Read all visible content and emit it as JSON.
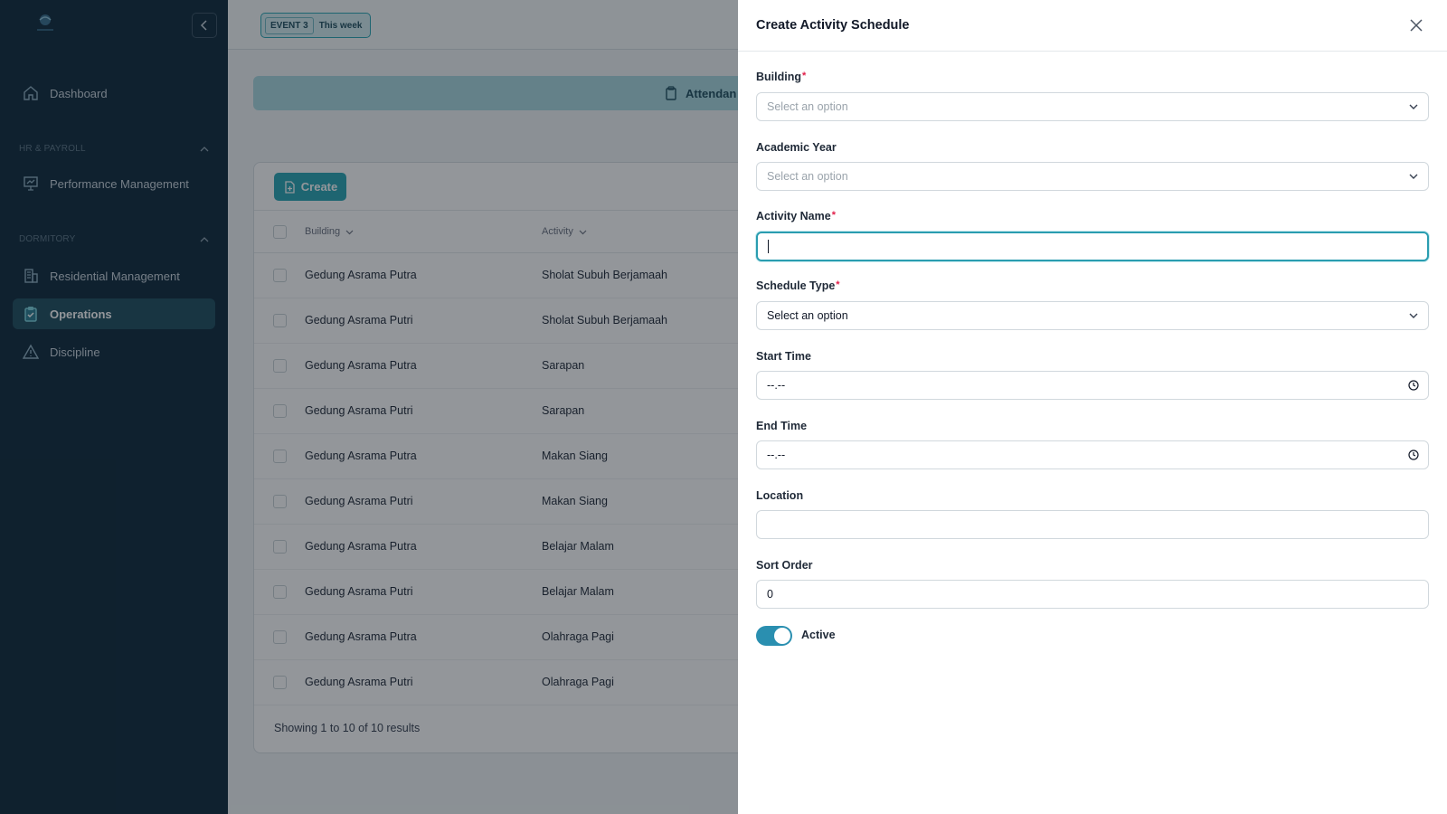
{
  "sidebar": {
    "logo_text": "GENERIC",
    "nav": [
      {
        "label": "Dashboard",
        "icon": "home-icon",
        "active": false
      },
      {
        "label": "Performance Management",
        "icon": "presentation-chart-icon",
        "active": false
      },
      {
        "label": "Residential Management",
        "icon": "building-icon",
        "active": false
      },
      {
        "label": "Operations",
        "icon": "clipboard-check-icon",
        "active": true
      },
      {
        "label": "Discipline",
        "icon": "warning-triangle-icon",
        "active": false
      }
    ],
    "sections": [
      {
        "label": "HR & PAYROLL"
      },
      {
        "label": "DORMITORY"
      }
    ]
  },
  "topbar": {
    "event_tag": "EVENT 3",
    "event_when": "This week"
  },
  "banner": {
    "label": "Attendan"
  },
  "table": {
    "create_label": "Create",
    "columns": [
      "Building",
      "Activity"
    ],
    "rows": [
      {
        "building": "Gedung Asrama Putra",
        "activity": "Sholat Subuh Berjamaah"
      },
      {
        "building": "Gedung Asrama Putri",
        "activity": "Sholat Subuh Berjamaah"
      },
      {
        "building": "Gedung Asrama Putra",
        "activity": "Sarapan"
      },
      {
        "building": "Gedung Asrama Putri",
        "activity": "Sarapan"
      },
      {
        "building": "Gedung Asrama Putra",
        "activity": "Makan Siang"
      },
      {
        "building": "Gedung Asrama Putri",
        "activity": "Makan Siang"
      },
      {
        "building": "Gedung Asrama Putra",
        "activity": "Belajar Malam"
      },
      {
        "building": "Gedung Asrama Putri",
        "activity": "Belajar Malam"
      },
      {
        "building": "Gedung Asrama Putra",
        "activity": "Olahraga Pagi"
      },
      {
        "building": "Gedung Asrama Putri",
        "activity": "Olahraga Pagi"
      }
    ],
    "footer": "Showing 1 to 10 of 10 results"
  },
  "drawer": {
    "title": "Create Activity Schedule",
    "required_mark": "*",
    "fields": {
      "building": {
        "label": "Building",
        "placeholder": "Select an option"
      },
      "academic_year": {
        "label": "Academic Year",
        "placeholder": "Select an option"
      },
      "activity_name": {
        "label": "Activity Name",
        "value": ""
      },
      "schedule_type": {
        "label": "Schedule Type",
        "value": "Select an option"
      },
      "start_time": {
        "label": "Start Time",
        "value": "--.--"
      },
      "end_time": {
        "label": "End Time",
        "value": "--.--"
      },
      "location": {
        "label": "Location",
        "value": ""
      },
      "sort_order": {
        "label": "Sort Order",
        "value": "0"
      }
    },
    "active_toggle": {
      "label": "Active",
      "on": true
    }
  },
  "colors": {
    "sidebar_bg": "#0f2a3c",
    "accent": "#2aa6b4",
    "toggle_on": "#2a8fb0",
    "required": "#e11d48"
  }
}
